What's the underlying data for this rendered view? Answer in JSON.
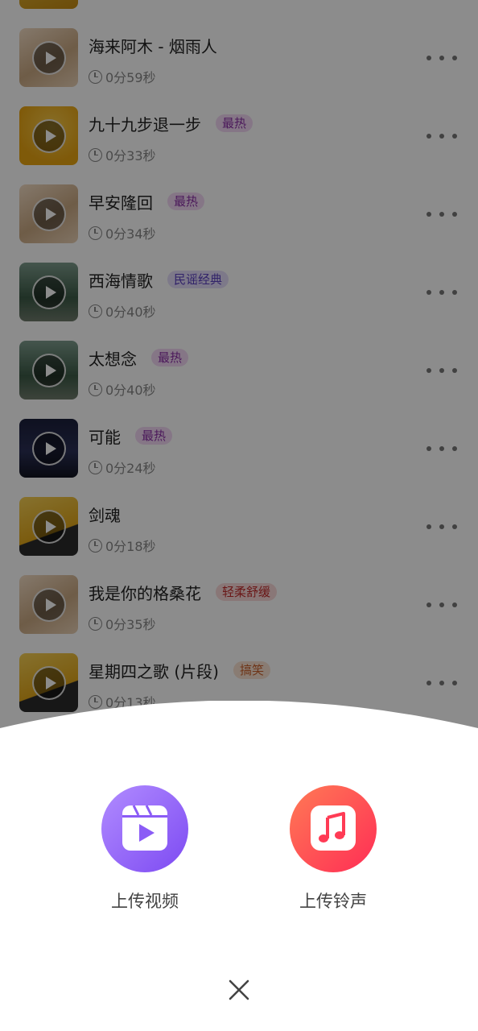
{
  "songs": [
    {
      "title": "海来阿木 - 烟雨人",
      "tag": "",
      "duration": "0分59秒"
    },
    {
      "title": "九十九步退一步",
      "tag": "最热",
      "duration": "0分33秒"
    },
    {
      "title": "早安隆回",
      "tag": "最热",
      "duration": "0分34秒"
    },
    {
      "title": "西海情歌",
      "tag": "民谣经典",
      "duration": "0分40秒"
    },
    {
      "title": "太想念",
      "tag": "最热",
      "duration": "0分40秒"
    },
    {
      "title": "可能",
      "tag": "最热",
      "duration": "0分24秒"
    },
    {
      "title": "剑魂",
      "tag": "",
      "duration": "0分18秒"
    },
    {
      "title": "我是你的格桑花",
      "tag": "轻柔舒缓",
      "duration": "0分35秒"
    },
    {
      "title": "星期四之歌 (片段)",
      "tag": "搞笑",
      "duration": "0分13秒"
    }
  ],
  "sheet": {
    "upload_video_label": "上传视频",
    "upload_ringtone_label": "上传铃声"
  },
  "icons": {
    "video": "video-reel-icon",
    "ringtone": "music-note-icon",
    "close": "close-icon",
    "more": "more-dots-icon",
    "clock": "clock-icon",
    "play": "play-icon"
  },
  "colors": {
    "upload_video_circle": "#9a6af7",
    "upload_ringtone_circle": "#ff4f55",
    "tag_hot": "#8a2fa6",
    "tag_folk": "#5a3fc0",
    "tag_soft": "#c22a2a",
    "tag_fun": "#c9602a"
  }
}
